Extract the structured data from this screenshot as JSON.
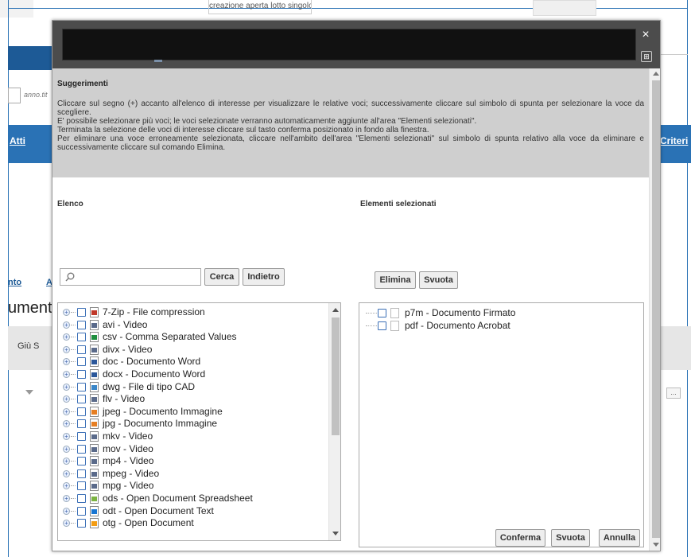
{
  "background": {
    "top_tab": "creazione aperta lotto singolo",
    "field_hint": "anno.tit",
    "nav_left": "Atti",
    "nav_right": "Criteri",
    "link_1": "nto",
    "link_2": "A",
    "heading": "ument",
    "giu": "Giù",
    "giu_extra": "S",
    "dots": "..."
  },
  "dialog": {
    "close_symbol": "×",
    "grid_symbol": "⊞",
    "hints": {
      "title": "Suggerimenti",
      "lines": [
        "Cliccare sul segno (+) accanto all'elenco di interesse per visualizzare le relative voci; successivamente cliccare sul simbolo di spunta per selezionare la voce da scegliere.",
        "E' possibile selezionare più voci; le voci selezionate verranno automaticamente aggiunte all'area \"Elementi selezionati\".",
        "Terminata la selezione delle voci di interesse cliccare sul tasto conferma posizionato in fondo alla finestra.",
        "Per eliminare una voce erroneamente selezionata, cliccare nell'ambito dell'area \"Elementi selezionati\" sul simbolo di spunta relativo alla voce da eliminare e successivamente cliccare sul comando Elimina."
      ]
    },
    "list_panel": {
      "title": "Elenco",
      "search_placeholder": "",
      "search_button": "Cerca",
      "back_button": "Indietro",
      "items": [
        {
          "label": "7-Zip - File compression",
          "icon": "zip-file-icon",
          "color": "#c0392b"
        },
        {
          "label": "avi - Video",
          "icon": "video-file-icon",
          "color": "#5a6a8a"
        },
        {
          "label": "csv - Comma Separated Values",
          "icon": "csv-file-icon",
          "color": "#1e8e3e"
        },
        {
          "label": "divx - Video",
          "icon": "video-file-icon",
          "color": "#5a6a8a"
        },
        {
          "label": "doc - Documento Word",
          "icon": "word-file-icon",
          "color": "#2b579a"
        },
        {
          "label": "docx - Documento Word",
          "icon": "word-file-icon",
          "color": "#2b579a"
        },
        {
          "label": "dwg - File di tipo CAD",
          "icon": "cad-file-icon",
          "color": "#3a86c8"
        },
        {
          "label": "flv - Video",
          "icon": "video-file-icon",
          "color": "#5a6a8a"
        },
        {
          "label": "jpeg - Documento Immagine",
          "icon": "image-file-icon",
          "color": "#e67e22"
        },
        {
          "label": "jpg - Documento Immagine",
          "icon": "image-file-icon",
          "color": "#e67e22"
        },
        {
          "label": "mkv - Video",
          "icon": "video-file-icon",
          "color": "#5a6a8a"
        },
        {
          "label": "mov - Video",
          "icon": "video-file-icon",
          "color": "#5a6a8a"
        },
        {
          "label": "mp4 - Video",
          "icon": "video-file-icon",
          "color": "#5a6a8a"
        },
        {
          "label": "mpeg - Video",
          "icon": "video-file-icon",
          "color": "#5a6a8a"
        },
        {
          "label": "mpg - Video",
          "icon": "video-file-icon",
          "color": "#5a6a8a"
        },
        {
          "label": "ods - Open Document Spreadsheet",
          "icon": "spreadsheet-file-icon",
          "color": "#7cb342"
        },
        {
          "label": "odt - Open Document Text",
          "icon": "text-file-icon",
          "color": "#1976d2"
        },
        {
          "label": "otg - Open Document",
          "icon": "drawing-file-icon",
          "color": "#f39c12"
        }
      ]
    },
    "selected_panel": {
      "title": "Elementi selezionati",
      "delete_button": "Elimina",
      "clear_button": "Svuota",
      "items": [
        {
          "label": "p7m - Documento Firmato",
          "icon": "file-icon"
        },
        {
          "label": "pdf - Documento Acrobat",
          "icon": "file-icon"
        }
      ]
    },
    "footer": {
      "confirm_button": "Conferma",
      "clear_button": "Svuota",
      "cancel_button": "Annulla"
    }
  }
}
